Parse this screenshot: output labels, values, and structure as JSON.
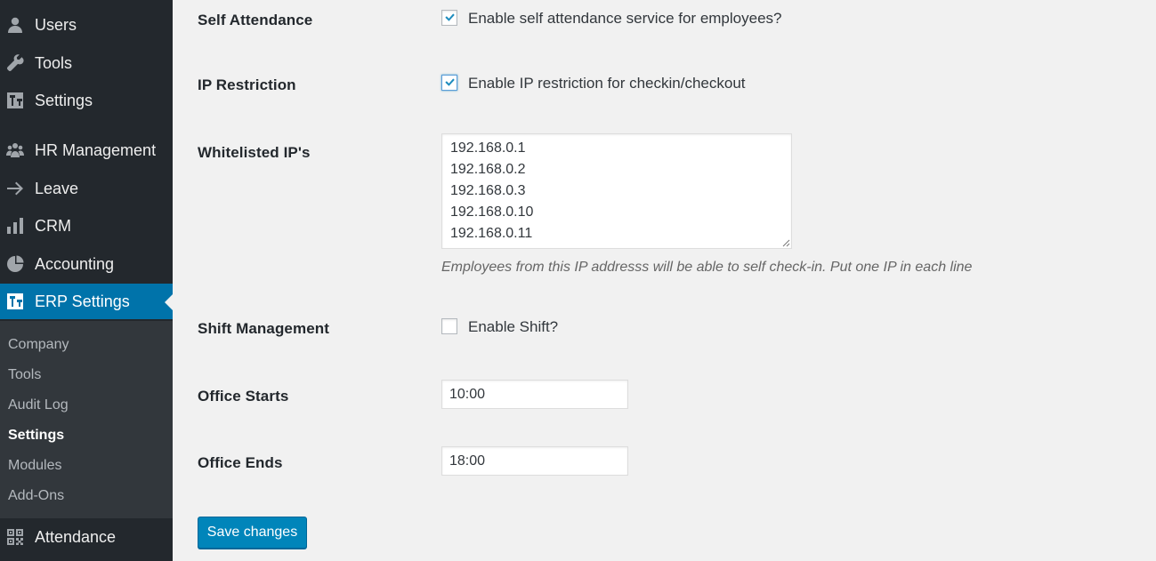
{
  "sidebar": {
    "menu": [
      {
        "label": "Users",
        "icon": "users-icon"
      },
      {
        "label": "Tools",
        "icon": "wrench-icon"
      },
      {
        "label": "Settings",
        "icon": "settings-icon"
      },
      {
        "label": "HR Management",
        "icon": "people-icon"
      },
      {
        "label": "Leave",
        "icon": "arrow-right-icon"
      },
      {
        "label": "CRM",
        "icon": "bar-chart-icon"
      },
      {
        "label": "Accounting",
        "icon": "pie-chart-icon"
      },
      {
        "label": "ERP Settings",
        "icon": "erp-settings-icon"
      },
      {
        "label": "Attendance",
        "icon": "qr-grid-icon"
      }
    ],
    "submenu": [
      "Company",
      "Tools",
      "Audit Log",
      "Settings",
      "Modules",
      "Add-Ons"
    ],
    "active_menu": "ERP Settings",
    "current_submenu": "Settings"
  },
  "form": {
    "self_attendance": {
      "label": "Self Attendance",
      "checkbox_text": "Enable self attendance service for employees?",
      "checked": true
    },
    "ip_restriction": {
      "label": "IP Restriction",
      "checkbox_text": "Enable IP restriction for checkin/checkout",
      "checked": true
    },
    "whitelisted_ips": {
      "label": "Whitelisted IP's",
      "lines": [
        "192.168.0.1",
        "192.168.0.2",
        "192.168.0.3",
        "192.168.0.10",
        "192.168.0.11"
      ],
      "description": "Employees from this IP addresss will be able to self check-in. Put one IP in each line"
    },
    "shift_management": {
      "label": "Shift Management",
      "checkbox_text": "Enable Shift?",
      "checked": false
    },
    "office_starts": {
      "label": "Office Starts",
      "value": "10:00"
    },
    "office_ends": {
      "label": "Office Ends",
      "value": "18:00"
    },
    "save_label": "Save changes"
  },
  "colors": {
    "sidebar_bg": "#23282d",
    "submenu_bg": "#32373c",
    "accent": "#0073aa",
    "button": "#0085ba",
    "checkmark": "#1e8cbe"
  }
}
